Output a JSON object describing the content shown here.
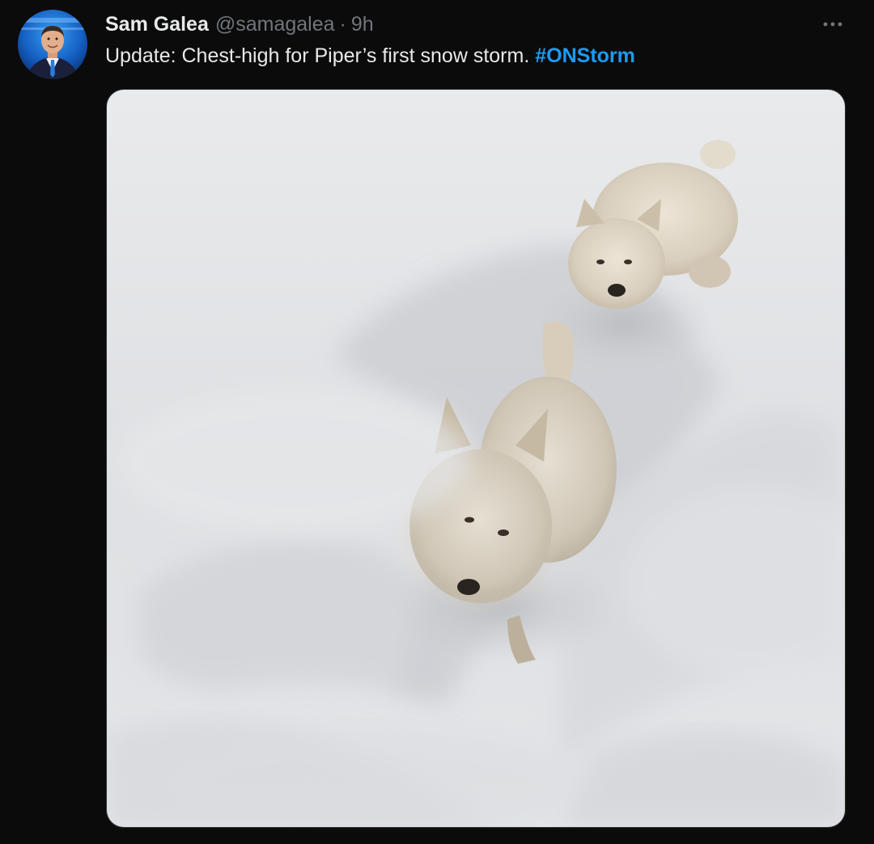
{
  "tweet": {
    "author": {
      "display_name": "Sam Galea",
      "handle": "@samagalea",
      "avatar_icon": "profile-photo-icon"
    },
    "separator": "·",
    "time": "9h",
    "text": "Update: Chest-high for Piper’s first snow storm.",
    "hashtag": "#ONStorm",
    "more_icon": "more-options-icon",
    "media": {
      "subject": "two-white-terriers-in-snow"
    }
  },
  "colors": {
    "background": "#000000",
    "text_primary": "#e7e9ea",
    "text_secondary": "#71767b",
    "hashtag": "#1d9bf0"
  }
}
